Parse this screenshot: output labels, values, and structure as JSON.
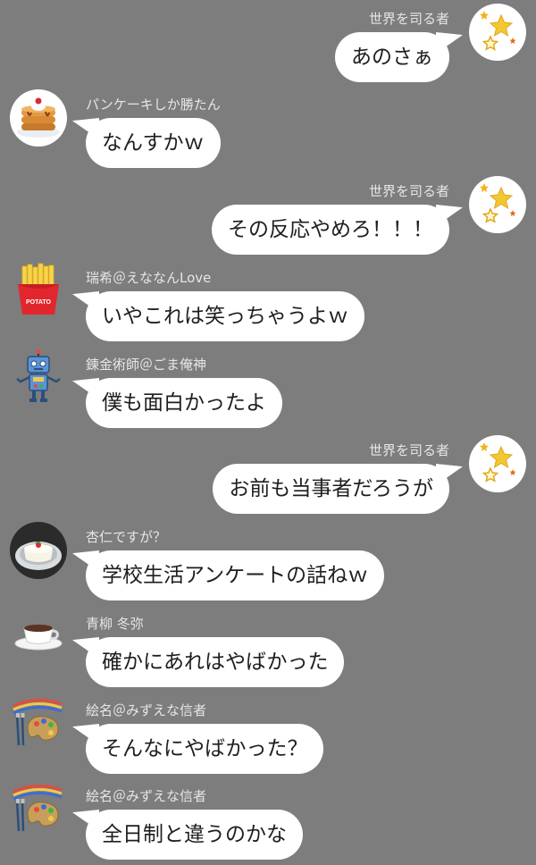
{
  "messages": [
    {
      "side": "right",
      "name": "世界を司る者",
      "text": "あのさぁ",
      "avatar": "stars-icon"
    },
    {
      "side": "left",
      "name": "パンケーキしか勝たん",
      "text": "なんすかｗ",
      "avatar": "pancake-icon"
    },
    {
      "side": "right",
      "name": "世界を司る者",
      "text": "その反応やめろ！！！",
      "avatar": "stars-icon"
    },
    {
      "side": "left",
      "name": "瑞希＠えななんLove",
      "text": "いやこれは笑っちゃうよｗ",
      "avatar": "french-fries-icon",
      "avatar_label": "POTATO"
    },
    {
      "side": "left",
      "name": "錬金術師＠ごま俺神",
      "text": "僕も面白かったよ",
      "avatar": "robot-icon"
    },
    {
      "side": "right",
      "name": "世界を司る者",
      "text": "お前も当事者だろうが",
      "avatar": "stars-icon"
    },
    {
      "side": "left",
      "name": "杏仁ですが？",
      "text": "学校生活アンケートの話ねｗ",
      "avatar": "almond-tofu-icon"
    },
    {
      "side": "left",
      "name": "青柳 冬弥",
      "text": "確かにあれはやばかった",
      "avatar": "coffee-cup-icon"
    },
    {
      "side": "left",
      "name": "絵名＠みずえな信者",
      "text": "そんなにやばかった？",
      "avatar": "paint-palette-icon"
    },
    {
      "side": "left",
      "name": "絵名＠みずえな信者",
      "text": "全日制と違うのかな",
      "avatar": "paint-palette-icon"
    }
  ],
  "colors": {
    "background": "#7d7d7d",
    "bubble": "#ffffff",
    "name_text": "#e6e6e6",
    "message_text": "#1e1e1e"
  }
}
